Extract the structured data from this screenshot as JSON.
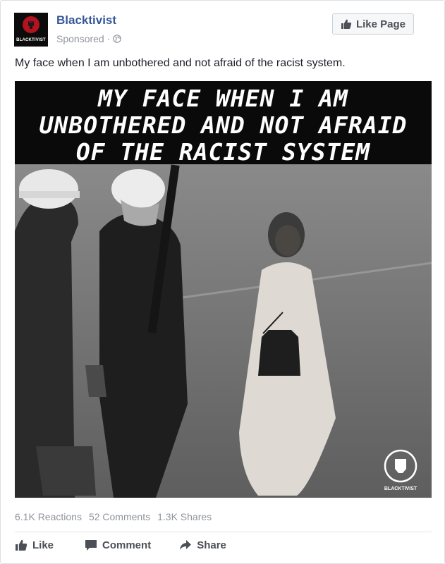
{
  "post": {
    "page_name": "Blacktivist",
    "avatar_text": "BLACKTIVIST",
    "sponsored_label": "Sponsored",
    "meta_separator": "·",
    "like_page_label": "Like Page",
    "text": "My face when I am unbothered and not afraid of the racist system.",
    "image_caption_lines": [
      "MY FACE WHEN I AM",
      "UNBOTHERED AND NOT AFRAID",
      "OF THE RACIST SYSTEM"
    ],
    "watermark_text": "BLACKTIVIST"
  },
  "stats": {
    "reactions": "6.1K Reactions",
    "comments": "52 Comments",
    "shares": "1.3K Shares"
  },
  "actions": {
    "like": "Like",
    "comment": "Comment",
    "share": "Share"
  },
  "colors": {
    "link_blue": "#365899",
    "meta_gray": "#90949c",
    "action_gray": "#4b4f56",
    "avatar_red": "#b3121f"
  },
  "icons": {
    "avatar": "fist-logo-icon",
    "privacy": "globe-icon",
    "like_page": "thumbs-up-icon",
    "like": "thumbs-up-icon",
    "comment": "comment-bubble-icon",
    "share": "share-arrow-icon"
  }
}
